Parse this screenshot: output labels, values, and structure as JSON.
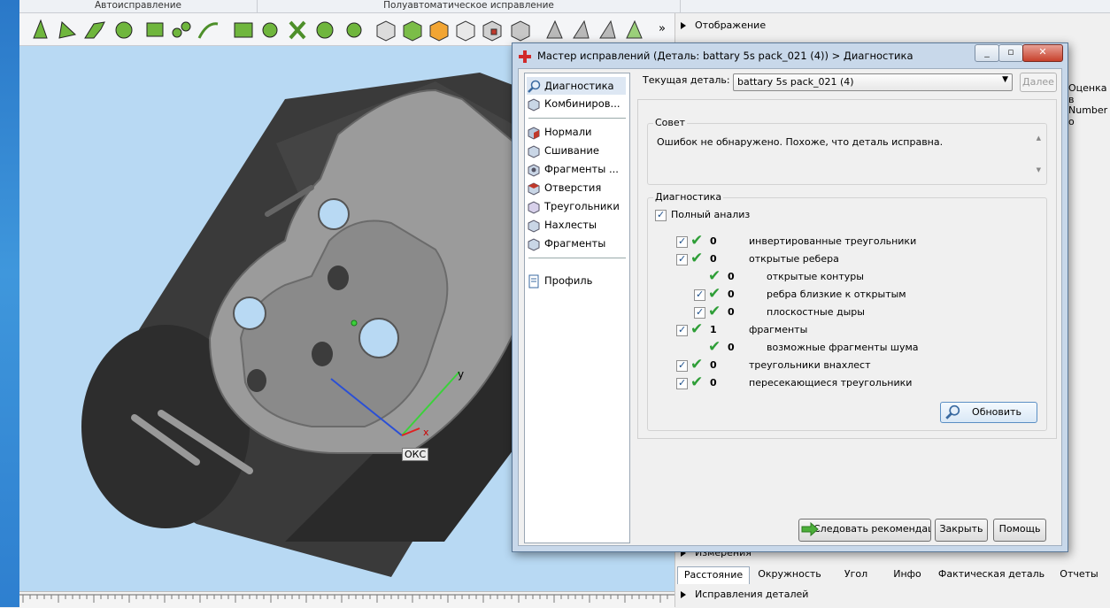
{
  "toolbar": {
    "group_auto": "Автоисправление",
    "group_semi": "Полуавтоматическое исправление",
    "more": "»"
  },
  "right_panel": {
    "display_header": "Отображение",
    "partial_a": "Оценка в",
    "partial_b": "Number o",
    "measurements_header": "Измерения",
    "fixes_header": "Исправления деталей",
    "tabs": [
      "Расстояние",
      "Окружность",
      "Угол",
      "Инфо",
      "Фактическая деталь",
      "Отчеты"
    ]
  },
  "viewport": {
    "axis_y": "y",
    "axis_x": "x",
    "ocs_label": "ОКС"
  },
  "dialog": {
    "title": "Мастер исправлений (Деталь: battary 5s pack_021 (4)) > Диагностика",
    "current_part_label": "Текущая деталь:",
    "current_part_value": "battary 5s pack_021 (4)",
    "next_button": "Далее",
    "advice_title": "Совет",
    "advice_text": "Ошибок не обнаружено. Похоже, что деталь исправна.",
    "diagnostics_title": "Диагностика",
    "full_analysis": "Полный анализ",
    "refresh_button": "Обновить",
    "follow_button": "Следовать рекомендациям",
    "close_button": "Закрыть",
    "help_button": "Помощь",
    "nav": [
      "Диагностика",
      "Комбиниров...",
      "Нормали",
      "Сшивание",
      "Фрагменты ...",
      "Отверстия",
      "Треугольники",
      "Нахлесты",
      "Фрагменты",
      "Профиль"
    ],
    "diag_rows": [
      {
        "count": "0",
        "label": "инвертированные треугольники"
      },
      {
        "count": "0",
        "label": "открытые ребера"
      },
      {
        "count": "0",
        "label": "открытые контуры"
      },
      {
        "count": "0",
        "label": "ребра близкие к открытым"
      },
      {
        "count": "0",
        "label": "плоскостные дыры"
      },
      {
        "count": "1",
        "label": "фрагменты"
      },
      {
        "count": "0",
        "label": "возможные фрагменты шума"
      },
      {
        "count": "0",
        "label": "треугольники внахлест"
      },
      {
        "count": "0",
        "label": "пересекающиеся треугольники"
      }
    ]
  }
}
